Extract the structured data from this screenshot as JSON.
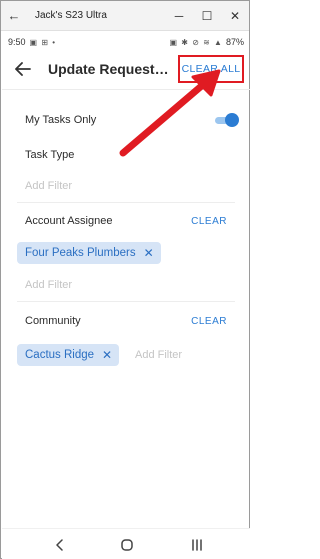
{
  "host_window": {
    "title": "Jack's S23 Ultra",
    "back_glyph": "←",
    "minimize_glyph": "─",
    "maximize_glyph": "☐",
    "close_glyph": "✕"
  },
  "status_bar": {
    "time": "9:50",
    "left_icons": "▣ ⊞ •",
    "right_icons": "▣ ✱ ⊘ ≋ ▲",
    "battery": "87%"
  },
  "app_bar": {
    "title": "Update Requests...",
    "clear_all_label": "CLEAR ALL",
    "back_icon": "arrow-left-icon"
  },
  "filters": {
    "my_tasks": {
      "label": "My Tasks Only",
      "enabled": true
    },
    "task_type": {
      "label": "Task Type",
      "placeholder": "Add Filter"
    },
    "account_assignee": {
      "label": "Account Assignee",
      "clear_label": "CLEAR",
      "chips": [
        "Four Peaks Plumbers"
      ],
      "placeholder": "Add Filter"
    },
    "community": {
      "label": "Community",
      "clear_label": "CLEAR",
      "chips": [
        "Cactus Ridge"
      ],
      "placeholder": "Add Filter"
    }
  },
  "chip_remove_glyph": "✕",
  "colors": {
    "accent": "#2b7cd3",
    "chip_bg": "#d6e4f6",
    "highlight": "#e01b22"
  }
}
